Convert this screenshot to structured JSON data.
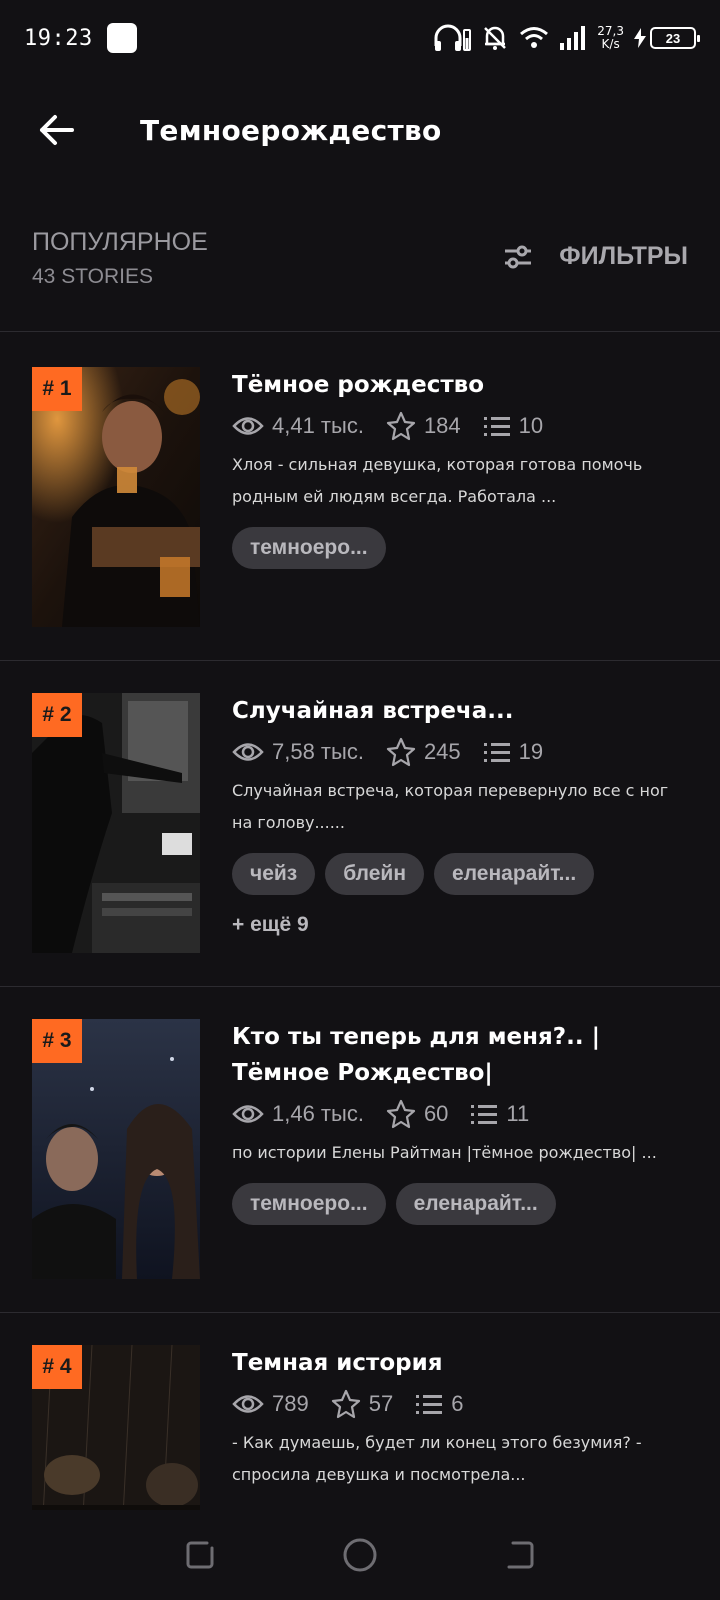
{
  "status": {
    "time": "19:23",
    "speed_top": "27,3",
    "speed_bottom": "K/s",
    "battery": "23"
  },
  "header": {
    "title": "Темноерождество"
  },
  "sort": {
    "label": "ПОПУЛЯРНОЕ",
    "count": "43 STORIES",
    "filters_label": "ФИЛЬТРЫ"
  },
  "stories": [
    {
      "rank": "# 1",
      "title": "Тёмное рождество",
      "views": "4,41 тыс.",
      "votes": "184",
      "parts": "10",
      "description": "Хлоя - сильная девушка, которая готова помочь родным ей людям всегда. Работала ...",
      "tags": [
        "темноеро..."
      ],
      "more": ""
    },
    {
      "rank": "# 2",
      "title": "Случайная встреча...",
      "views": "7,58 тыс.",
      "votes": "245",
      "parts": "19",
      "description": "Случайная встреча, которая перевернуло все с ног на голову......",
      "tags": [
        "чейз",
        "блейн",
        "еленарайт..."
      ],
      "more": "+ ещё 9"
    },
    {
      "rank": "# 3",
      "title": "Кто ты теперь для меня?.. | Тёмное Рождество|",
      "views": "1,46 тыс.",
      "votes": "60",
      "parts": "11",
      "description": "по истории Елены Райтман |тёмное рождество| ...",
      "tags": [
        "темноеро...",
        "еленарайт..."
      ],
      "more": ""
    },
    {
      "rank": "# 4",
      "title": "Темная история",
      "views": "789",
      "votes": "57",
      "parts": "6",
      "description": "- Как думаешь, будет ли конец этого безумия? - спросила девушка и посмотрела...",
      "tags": [],
      "more": ""
    }
  ],
  "colors": {
    "background": "#121114",
    "rank_badge": "#ff6a22",
    "tag_bg": "#3a393e"
  }
}
